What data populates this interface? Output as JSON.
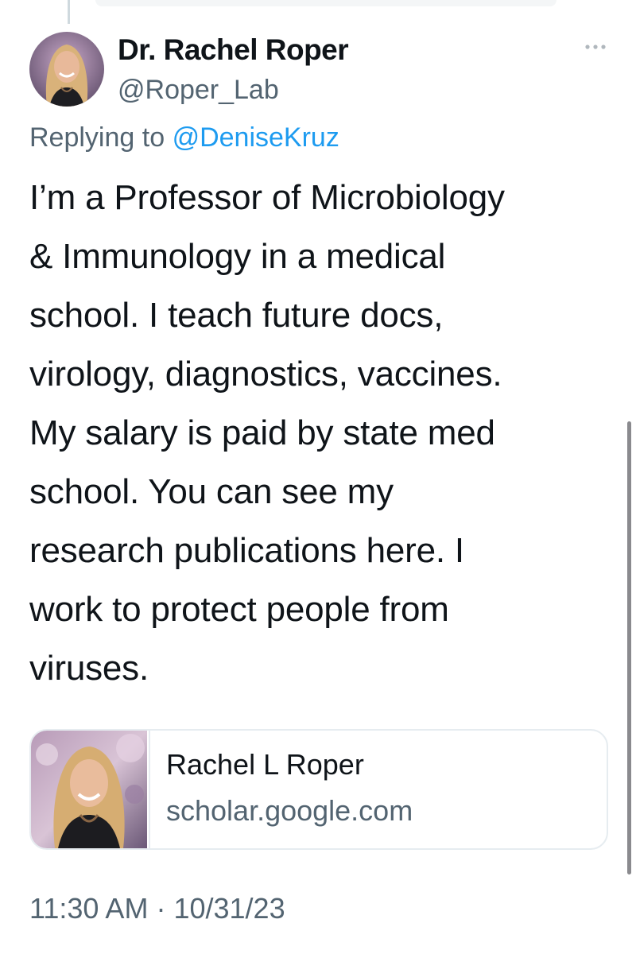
{
  "tweet": {
    "author": {
      "display_name": "Dr. Rachel Roper",
      "handle": "@Roper_Lab",
      "avatar_icon": "profile-photo"
    },
    "more_icon": "more-dots-icon",
    "replying_to": {
      "prefix": "Replying to",
      "mention": "@DeniseKruz"
    },
    "text_lines": [
      "I’m a Professor of Microbiology",
      "& Immunology in a medical",
      "school. I teach future docs,",
      "virology, diagnostics, vaccines.",
      "My salary is paid by state med",
      "school. You can see my",
      "research publications here. I",
      "work to protect people from",
      "viruses."
    ],
    "link_card": {
      "title": "Rachel L Roper",
      "domain": "scholar.google.com",
      "thumbnail_icon": "profile-photo"
    },
    "time": "11:30 AM",
    "separator": "·",
    "date": "10/31/23"
  },
  "colors": {
    "text_primary": "#0f1419",
    "text_secondary": "#536471",
    "link_blue": "#1d9bf0",
    "border": "#e6ecf0"
  }
}
